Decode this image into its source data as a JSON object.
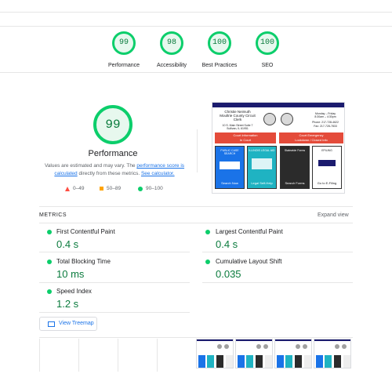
{
  "scores": [
    {
      "label": "Performance",
      "value": "99"
    },
    {
      "label": "Accessibility",
      "value": "98"
    },
    {
      "label": "Best Practices",
      "value": "100"
    },
    {
      "label": "SEO",
      "value": "100"
    }
  ],
  "performance": {
    "score": "99",
    "title": "Performance",
    "note_prefix": "Values are estimated and may vary. The ",
    "note_link": "performance score is calculated",
    "note_mid": " directly from these metrics. ",
    "note_link2": "See calculator."
  },
  "legend": {
    "fail": "0–49",
    "average": "50–89",
    "pass": "90–100"
  },
  "colors": {
    "pass": "#0cce6b",
    "average": "#ffa400",
    "fail": "#ff4e42",
    "link": "#1a73e8"
  },
  "preview": {
    "name_line1": "Christie Neimuth",
    "name_line2": "Moultrie County Circuit",
    "name_line3": "Clerk",
    "address": "10 S. Main Street Suite 7\nSullivan, IL 61951",
    "hours": "Monday – Friday\n8:30am – 4:30pm",
    "phone": "Phone: 217-728-4622",
    "fax": "Fax: 217-728-7833",
    "banner_left_1": "Court Information",
    "banner_left_2": "In Court",
    "banner_right_1": "Court Emergency",
    "banner_right_2": "Lockdown / Closed Info",
    "tiles": [
      "Search Now",
      "Legal Self-Help",
      "Search Forms",
      "Go to E-Filing"
    ],
    "tile_headers": [
      "PUBLIC CASE SEARCH",
      "ILLINOIS LEGAL AID",
      "Statewide Forms",
      "EFILING"
    ]
  },
  "metrics": {
    "heading": "METRICS",
    "expand": "Expand view",
    "items": [
      {
        "label": "First Contentful Paint",
        "value": "0.4 s"
      },
      {
        "label": "Largest Contentful Paint",
        "value": "0.4 s"
      },
      {
        "label": "Total Blocking Time",
        "value": "10 ms"
      },
      {
        "label": "Cumulative Layout Shift",
        "value": "0.035"
      },
      {
        "label": "Speed Index",
        "value": "1.2 s"
      }
    ],
    "treemap_label": "View Treemap"
  },
  "icons": {
    "treemap": "treemap-icon",
    "fail": "triangle-icon",
    "average": "square-icon",
    "pass": "circle-icon"
  }
}
